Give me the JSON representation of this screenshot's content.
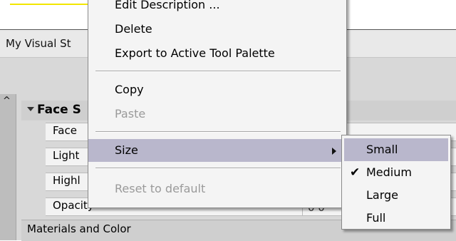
{
  "app": {
    "tab_label": "My Visual St",
    "panel_caret_icon": "caret-up-icon",
    "section_title": "Face S",
    "properties": [
      "Face",
      "Light",
      "Highl",
      "Opacity"
    ],
    "materials_section": "Materials and Color",
    "value_snippet": "0 0"
  },
  "context_menu": {
    "items": [
      {
        "label": "Edit Description ...",
        "enabled": true
      },
      {
        "label": "Delete",
        "enabled": true
      },
      {
        "label": "Export to Active Tool Palette",
        "enabled": true
      },
      {
        "label": "Copy",
        "enabled": true
      },
      {
        "label": "Paste",
        "enabled": false
      },
      {
        "label": "Size",
        "enabled": true,
        "highlighted": true,
        "has_submenu": true
      },
      {
        "label": "Reset to default",
        "enabled": false
      }
    ]
  },
  "size_submenu": {
    "items": [
      {
        "label": "Small",
        "highlighted": true,
        "checked": false
      },
      {
        "label": "Medium",
        "highlighted": false,
        "checked": true
      },
      {
        "label": "Large",
        "highlighted": false,
        "checked": false
      },
      {
        "label": "Full",
        "highlighted": false,
        "checked": false
      }
    ],
    "check_glyph": "✔"
  },
  "colors": {
    "highlight": "#b9b7cc",
    "disabled_text": "#9a9a9a",
    "menu_bg": "#f4f4f4"
  }
}
